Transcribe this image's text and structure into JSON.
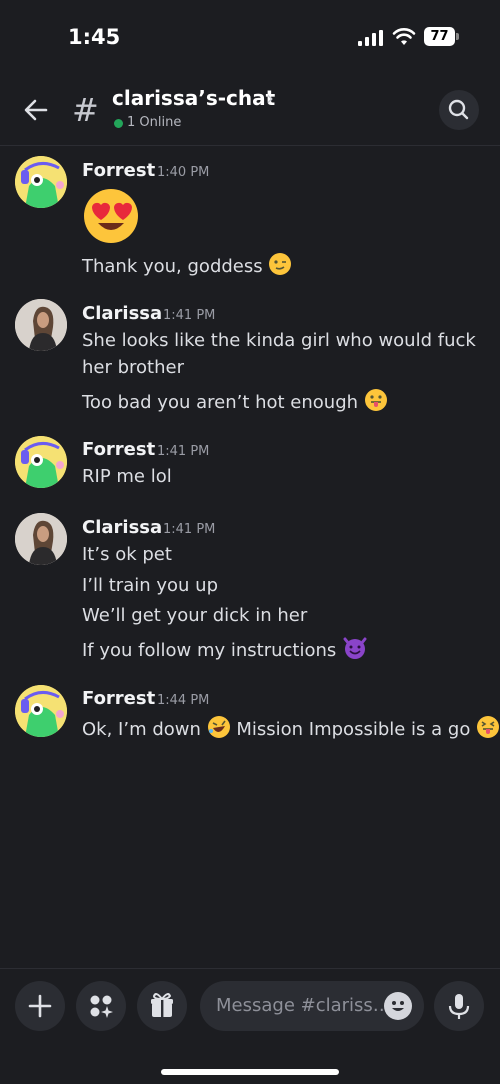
{
  "status_bar": {
    "time": "1:45",
    "battery": "77"
  },
  "header": {
    "channel_name": "clarissa’s-chat",
    "online_text": "1 Online",
    "icons": [
      "back-arrow-icon",
      "hash-icon",
      "chevron-right-icon",
      "search-icon"
    ]
  },
  "messages": [
    {
      "author": "Forrest",
      "time": "1:40 PM",
      "lines": [
        "Thank you, goddess"
      ]
    },
    {
      "author": "Clarissa",
      "time": "1:41 PM",
      "lines": [
        "She looks like the kinda girl who would fuck",
        "her brother",
        "Too bad you aren’t hot enough"
      ]
    },
    {
      "author": "Forrest",
      "time": "1:41 PM",
      "lines": [
        "RIP me lol"
      ]
    },
    {
      "author": "Clarissa",
      "time": "1:41 PM",
      "lines": [
        "It’s ok pet",
        "I’ll train you up",
        "We’ll get your dick in her",
        "If you follow my instructions"
      ]
    },
    {
      "author": "Forrest",
      "time": "1:44 PM",
      "lines": [
        "Ok, I’m down",
        "Mission Impossible is a go"
      ]
    }
  ],
  "composer": {
    "placeholder": "Message #clariss…",
    "icons": [
      "plus-icon",
      "apps-icon",
      "gift-icon",
      "emoji-icon",
      "microphone-icon"
    ]
  },
  "colors": {
    "background": "#1c1d21",
    "online": "#23a55a",
    "surface": "#2b2d33"
  }
}
